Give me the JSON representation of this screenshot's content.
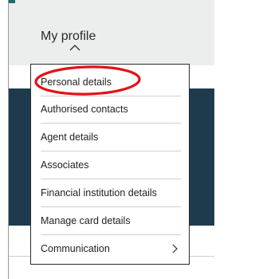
{
  "header": {
    "title": "My profile"
  },
  "menu": {
    "items": [
      {
        "label": "Personal details"
      },
      {
        "label": "Authorised contacts"
      },
      {
        "label": "Agent details"
      },
      {
        "label": "Associates"
      },
      {
        "label": "Financial institution details"
      },
      {
        "label": "Manage card details"
      },
      {
        "label": "Communication"
      }
    ]
  },
  "annotation": {
    "highlight_color": "#e4101a"
  },
  "colors": {
    "header_bg": "#eceded",
    "dark_panel": "#1e3b4d",
    "accent_strip": "#1b6b6b"
  }
}
